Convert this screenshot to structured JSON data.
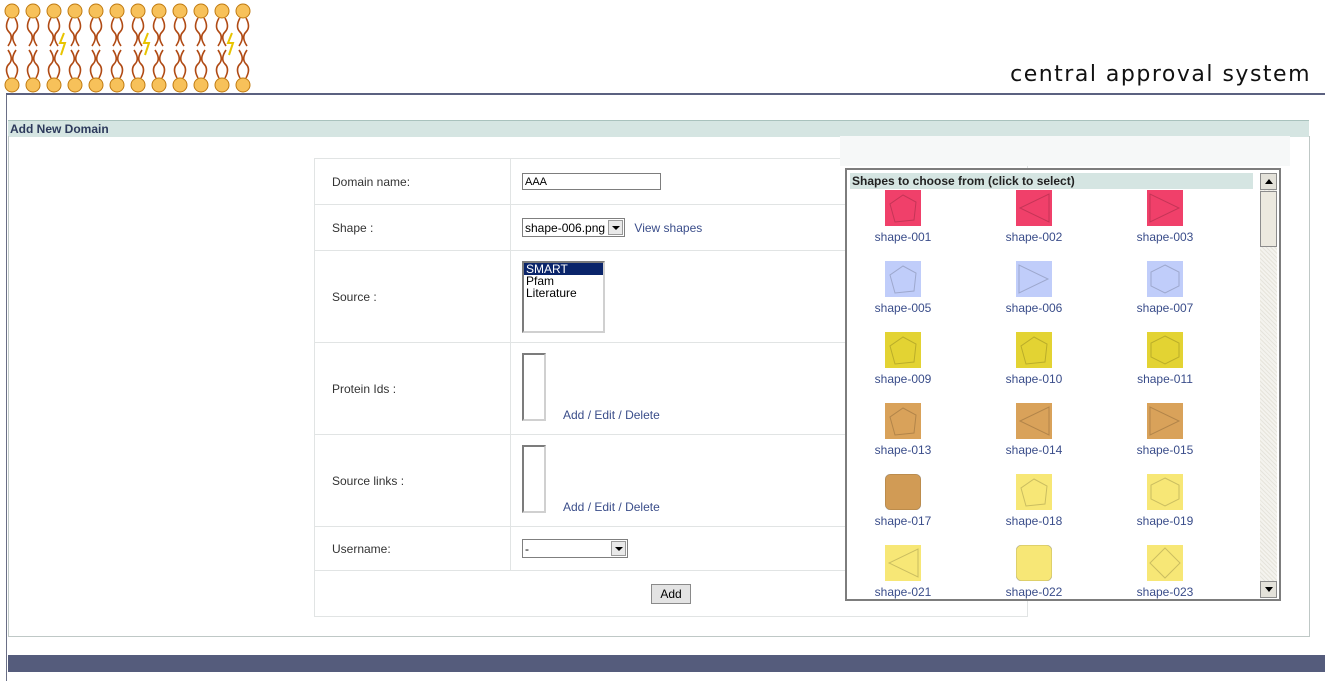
{
  "header": {
    "site_title": "central approval system"
  },
  "section": {
    "title": "Add New Domain"
  },
  "form": {
    "domain_name_label": "Domain name:",
    "domain_name_value": "AAA",
    "shape_label": "Shape :",
    "shape_selected": "shape-006.png",
    "view_shapes_link": "View shapes",
    "source_label": "Source :",
    "source_options": [
      "SMART",
      "Pfam",
      "Literature"
    ],
    "protein_ids_label": "Protein Ids :",
    "add_label": "Add",
    "sep1": " / ",
    "edit_label": "Edit",
    "sep2": " / ",
    "delete_label": "Delete",
    "source_links_label": "Source links :",
    "username_label": "Username:",
    "username_selected": "-",
    "submit_label": "Add"
  },
  "popup": {
    "title": "Shapes to choose from (click to select)",
    "shapes": [
      {
        "name": "shape-001",
        "color": "#f0406a",
        "kind": "pentagon"
      },
      {
        "name": "shape-002",
        "color": "#f0406a",
        "kind": "tri-left"
      },
      {
        "name": "shape-003",
        "color": "#f0406a",
        "kind": "tri-right"
      },
      {
        "name": "shape-005",
        "color": "#c0cdfa",
        "kind": "pentagon"
      },
      {
        "name": "shape-006",
        "color": "#c0cdfa",
        "kind": "tri-right"
      },
      {
        "name": "shape-007",
        "color": "#c0cdfa",
        "kind": "hexagon"
      },
      {
        "name": "shape-009",
        "color": "#e3d333",
        "kind": "pentagon"
      },
      {
        "name": "shape-010",
        "color": "#e3d333",
        "kind": "pentagon"
      },
      {
        "name": "shape-011",
        "color": "#e3d333",
        "kind": "hexagon"
      },
      {
        "name": "shape-013",
        "color": "#d9a25a",
        "kind": "pentagon"
      },
      {
        "name": "shape-014",
        "color": "#d9a25a",
        "kind": "tri-left"
      },
      {
        "name": "shape-015",
        "color": "#d9a25a",
        "kind": "tri-right"
      },
      {
        "name": "shape-017",
        "color": "#d19b55",
        "kind": "rounded"
      },
      {
        "name": "shape-018",
        "color": "#f7e776",
        "kind": "pentagon"
      },
      {
        "name": "shape-019",
        "color": "#f7e776",
        "kind": "hexagon"
      },
      {
        "name": "shape-021",
        "color": "#f7e776",
        "kind": "tri-left"
      },
      {
        "name": "shape-022",
        "color": "#f7e776",
        "kind": "rounded"
      },
      {
        "name": "shape-023",
        "color": "#f7e776",
        "kind": "diamond"
      }
    ]
  },
  "colors": {
    "header_line": "#5b6180",
    "section_bar": "#d5e5e2",
    "link": "#3a4d8a",
    "footer": "#555c7c"
  }
}
